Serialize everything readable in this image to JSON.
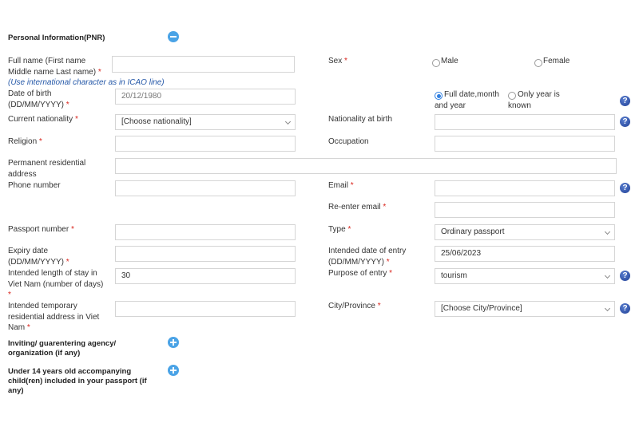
{
  "section": {
    "title": "Personal Information(PNR)",
    "toggle_icon": "minus-circle-icon"
  },
  "fields": {
    "full_name": {
      "label": "Full name (First name Middle name Last name)",
      "required": "*",
      "value": "",
      "hint": "(Use international character as in ICAO line)"
    },
    "sex": {
      "label": "Sex",
      "required": "*",
      "options": [
        "Male",
        "Female"
      ],
      "selected": null
    },
    "dob": {
      "label": "Date of birth (DD/MM/YYYY)",
      "required": "*",
      "placeholder": "20/12/1980",
      "value": ""
    },
    "dob_mode": {
      "options": [
        "Full date,month and year",
        "Only year is known"
      ],
      "selected": "Full date,month and year"
    },
    "current_nationality": {
      "label": "Current nationality",
      "required": "*",
      "value": "[Choose nationality]"
    },
    "nationality_at_birth": {
      "label": "Nationality at birth",
      "value": ""
    },
    "religion": {
      "label": "Religion",
      "required": "*",
      "value": ""
    },
    "occupation": {
      "label": "Occupation",
      "value": ""
    },
    "permanent_address": {
      "label": "Permanent residential address",
      "value": ""
    },
    "phone": {
      "label": "Phone number",
      "value": ""
    },
    "email": {
      "label": "Email",
      "required": "*",
      "value": ""
    },
    "reenter_email": {
      "label": "Re-enter email",
      "required": "*",
      "value": ""
    },
    "passport_number": {
      "label": "Passport number",
      "required": "*",
      "value": ""
    },
    "passport_type": {
      "label": "Type",
      "required": "*",
      "value": "Ordinary passport"
    },
    "expiry_date": {
      "label": "Expiry date (DD/MM/YYYY)",
      "required": "*",
      "value": ""
    },
    "entry_date": {
      "label": "Intended date of entry (DD/MM/YYYY)",
      "required": "*",
      "value": "25/06/2023"
    },
    "length_of_stay": {
      "label": "Intended length of stay in Viet Nam (number of days)",
      "required": "*",
      "value": "30"
    },
    "purpose": {
      "label": "Purpose of entry",
      "required": "*",
      "value": "tourism"
    },
    "temp_address": {
      "label": "Intended temporary residential address in Viet Nam",
      "required": "*",
      "value": ""
    },
    "city": {
      "label": "City/Province",
      "required": "*",
      "value": "[Choose City/Province]"
    }
  },
  "sections_collapsed": [
    {
      "title": "Inviting/ guarentering agency/ organization (if any)",
      "icon": "plus-circle-icon"
    },
    {
      "title": "Under 14 years old accompanying child(ren) included in your passport (if any)",
      "icon": "plus-circle-icon"
    }
  ],
  "help_icon_text": "?"
}
